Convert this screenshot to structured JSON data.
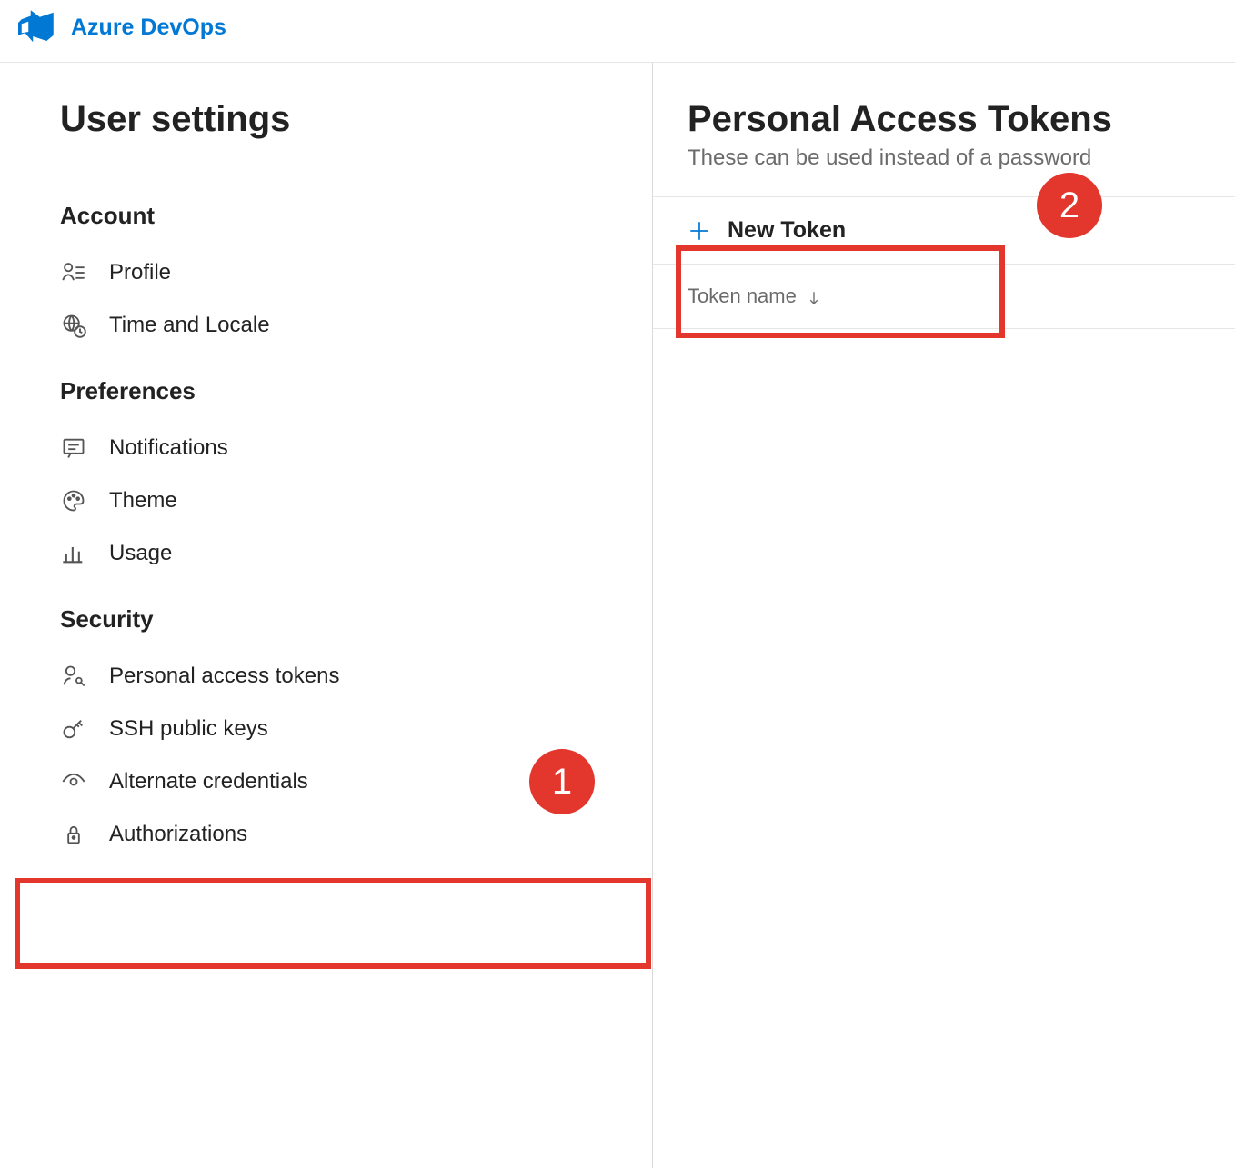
{
  "brand": "Azure DevOps",
  "sidebar": {
    "title": "User settings",
    "sections": [
      {
        "heading": "Account",
        "items": [
          {
            "label": "Profile",
            "name": "profile"
          },
          {
            "label": "Time and Locale",
            "name": "time-and-locale"
          }
        ]
      },
      {
        "heading": "Preferences",
        "items": [
          {
            "label": "Notifications",
            "name": "notifications"
          },
          {
            "label": "Theme",
            "name": "theme"
          },
          {
            "label": "Usage",
            "name": "usage"
          }
        ]
      },
      {
        "heading": "Security",
        "items": [
          {
            "label": "Personal access tokens",
            "name": "personal-access-tokens"
          },
          {
            "label": "SSH public keys",
            "name": "ssh-public-keys"
          },
          {
            "label": "Alternate credentials",
            "name": "alternate-credentials"
          },
          {
            "label": "Authorizations",
            "name": "authorizations"
          }
        ]
      }
    ]
  },
  "content": {
    "title": "Personal Access Tokens",
    "subtitle": "These can be used instead of a password",
    "newTokenLabel": "New Token",
    "columnHeader": "Token name"
  },
  "annotations": {
    "badge1": "1",
    "badge2": "2"
  }
}
